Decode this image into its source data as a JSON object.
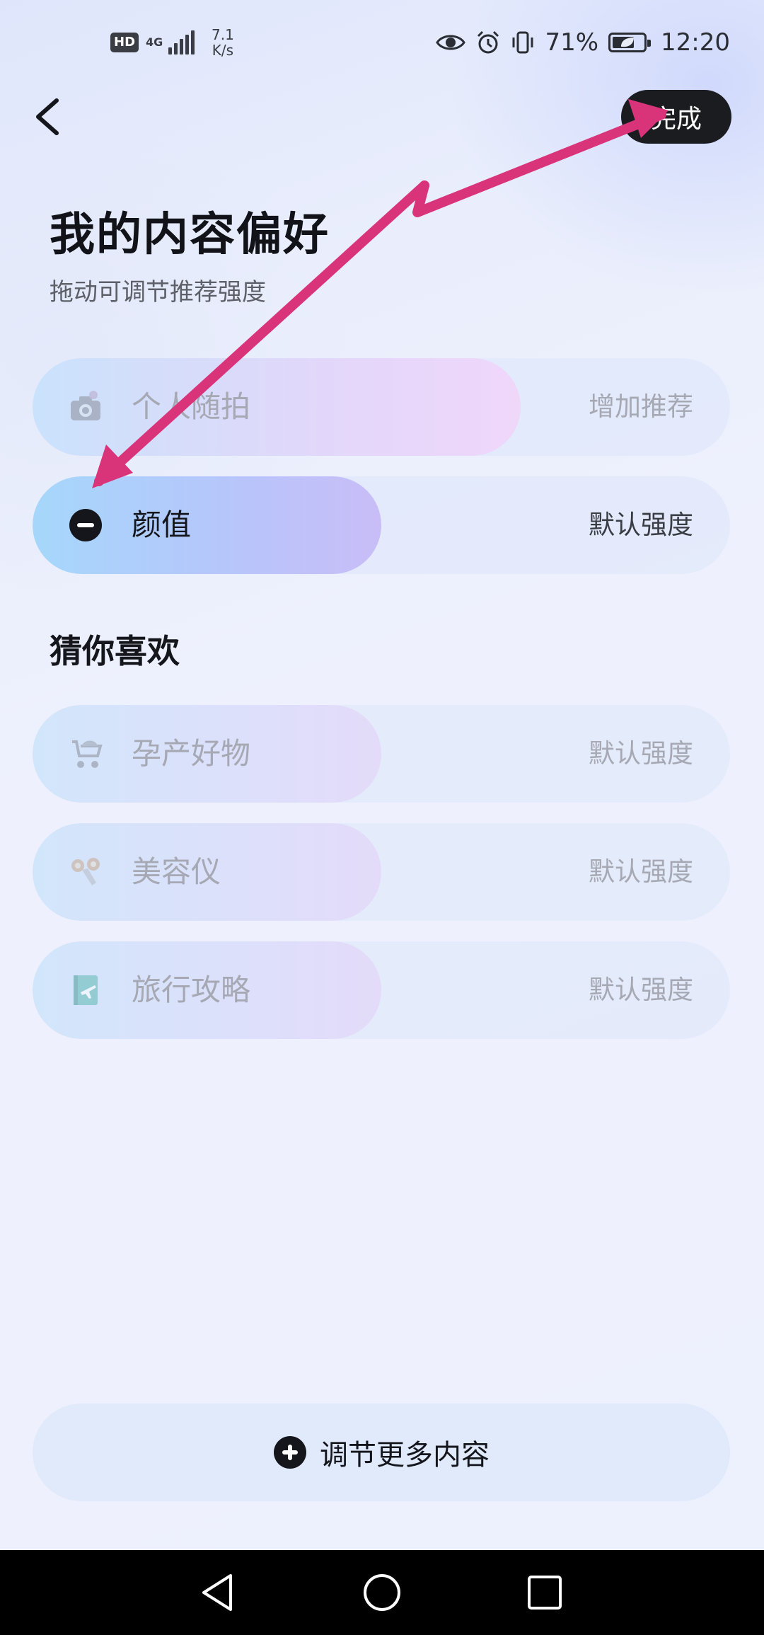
{
  "status_bar": {
    "hd": "HD",
    "network": "4G",
    "speed_value": "7.1",
    "speed_unit": "K/s",
    "battery_pct": "71%",
    "battery_level": 0.71,
    "time": "12:20"
  },
  "header": {
    "done_label": "完成",
    "title": "我的内容偏好",
    "subtitle": "拖动可调节推荐强度"
  },
  "preferences": [
    {
      "label": "个人随拍",
      "strength": "增加推荐",
      "icon": "camera-icon",
      "level": 0.7,
      "state": "faded"
    },
    {
      "label": "颜值",
      "strength": "默认强度",
      "icon": "minus-circle-icon",
      "level": 0.5,
      "state": "active"
    }
  ],
  "guess": {
    "title": "猜你喜欢",
    "items": [
      {
        "label": "孕产好物",
        "strength": "默认强度",
        "icon": "stroller-icon",
        "level": 0.5
      },
      {
        "label": "美容仪",
        "strength": "默认强度",
        "icon": "beauty-device-icon",
        "level": 0.5
      },
      {
        "label": "旅行攻略",
        "strength": "默认强度",
        "icon": "travel-guide-icon",
        "level": 0.5
      }
    ]
  },
  "more_button": {
    "label": "调节更多内容",
    "icon": "plus-circle-icon"
  },
  "colors": {
    "accent_dark": "#1b1c20",
    "annotation_arrow": "#d9347a",
    "fill_start": "#a9d6fb",
    "fill_end": "#c9bff8"
  }
}
